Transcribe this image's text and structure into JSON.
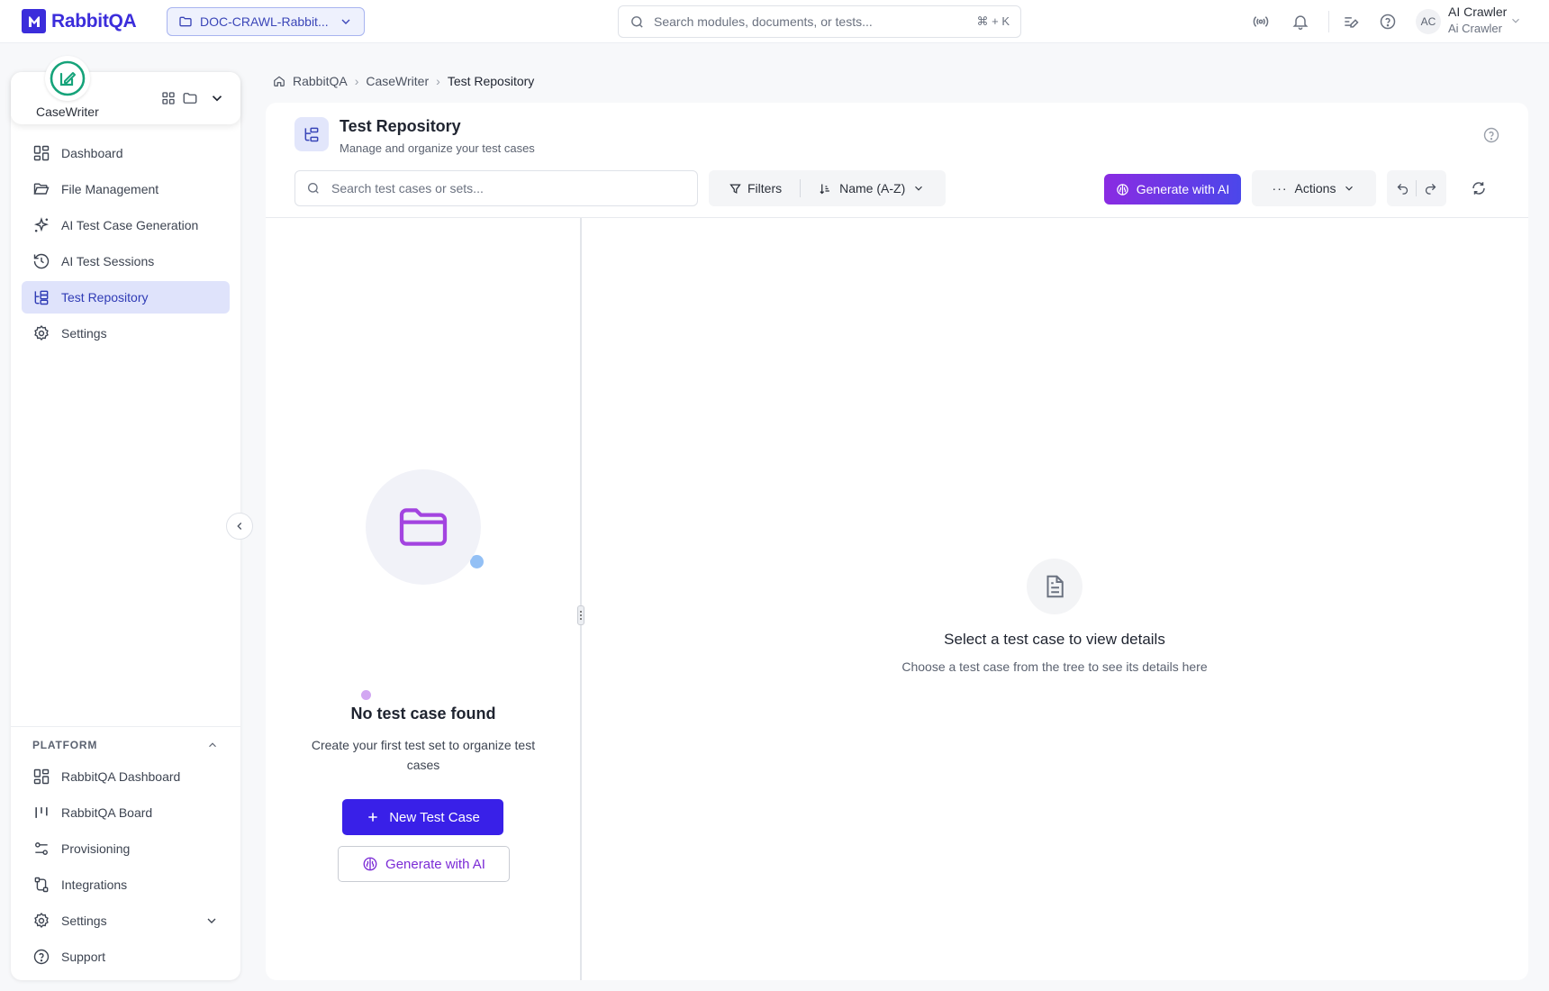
{
  "topbar": {
    "logo_text": "RabbitQA",
    "project": "DOC-CRAWL-Rabbit...",
    "search_placeholder": "Search modules, documents, or tests...",
    "search_shortcut": "⌘ + K",
    "user_initials": "AC",
    "user_name": "AI Crawler",
    "user_role": "Ai Crawler"
  },
  "sidebar": {
    "app_name": "CaseWriter",
    "app_color": "#16a37a",
    "nav": [
      {
        "label": "Dashboard",
        "icon": "grid-icon"
      },
      {
        "label": "File Management",
        "icon": "folder-open-icon"
      },
      {
        "label": "AI Test Case Generation",
        "icon": "sparkles-icon"
      },
      {
        "label": "AI Test Sessions",
        "icon": "history-icon"
      },
      {
        "label": "Test Repository",
        "icon": "tree-icon",
        "active": true
      },
      {
        "label": "Settings",
        "icon": "gear-icon"
      }
    ],
    "platform_title": "PLATFORM",
    "platform_nav": [
      {
        "label": "RabbitQA Dashboard",
        "icon": "grid-icon"
      },
      {
        "label": "RabbitQA Board",
        "icon": "board-icon"
      },
      {
        "label": "Provisioning",
        "icon": "sliders-icon"
      },
      {
        "label": "Integrations",
        "icon": "integrations-icon"
      },
      {
        "label": "Settings",
        "icon": "gear-icon"
      },
      {
        "label": "Support",
        "icon": "help-icon"
      }
    ]
  },
  "breadcrumb": [
    "RabbitQA",
    "CaseWriter",
    "Test Repository"
  ],
  "page": {
    "title": "Test Repository",
    "subtitle": "Manage and organize your test cases"
  },
  "toolbar": {
    "search_placeholder": "Search test cases or sets...",
    "filters_label": "Filters",
    "sort_label": "Name (A-Z)",
    "generate_label": "Generate with AI",
    "actions_label": "Actions"
  },
  "empty_tree": {
    "title": "No test case found",
    "description": "Create your first test set to organize test cases",
    "new_button": "New Test Case",
    "generate_button": "Generate with AI"
  },
  "details": {
    "title": "Select a test case to view details",
    "description": "Choose a test case from the tree to see its details here"
  },
  "colors": {
    "brand": "#3b2ddb",
    "primary_button": "#3920e8",
    "ai_gradient_start": "#8a2be2",
    "ai_gradient_end": "#4b47ea",
    "active_nav_bg": "#dfe3fb"
  }
}
